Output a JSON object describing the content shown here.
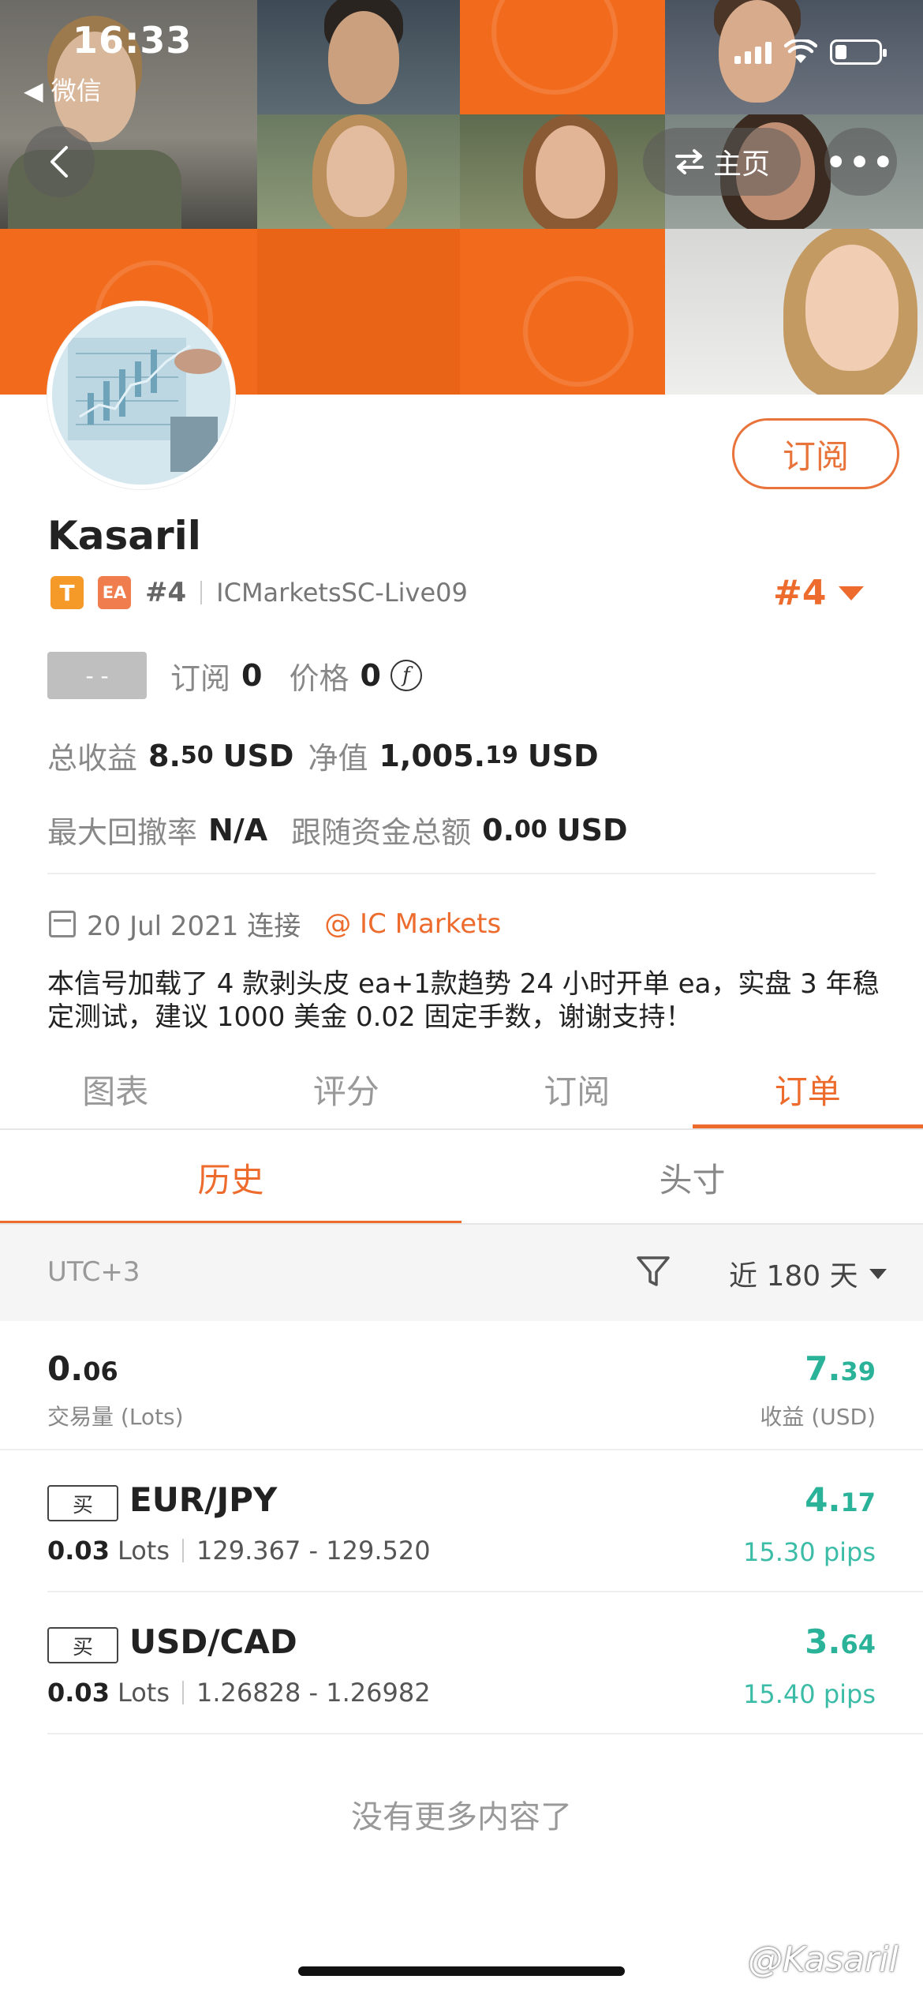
{
  "status_bar": {
    "time": "16:33",
    "back_app": "◀ 微信"
  },
  "nav": {
    "back_icon": "chevron-left-icon",
    "home_label": "主页",
    "more_label": "•••"
  },
  "profile": {
    "subscribe_label": "订阅",
    "name": "Kasaril",
    "badge_t": "T",
    "badge_ea": "EA",
    "rank_small": "#4",
    "server": "ICMarketsSC-Live09",
    "rank_big": "#4",
    "level": "- -",
    "subs_label": "订阅",
    "subs_value": "0",
    "price_label": "价格",
    "price_value": "0",
    "coin_symbol": "f",
    "total_profit_label": "总收益",
    "total_profit_int": "8.",
    "total_profit_dec": "50",
    "total_profit_unit": "USD",
    "equity_label": "净值",
    "equity_int": "1,005.",
    "equity_dec": "19",
    "equity_unit": "USD",
    "max_dd_label": "最大回撤率",
    "max_dd_value": "N/A",
    "follow_funds_label": "跟随资金总额",
    "follow_funds_int": "0.",
    "follow_funds_dec": "00",
    "follow_funds_unit": "USD",
    "connected_date": "20 Jul 2021 连接",
    "broker": "@ IC Markets",
    "description": "本信号加载了 4 款剥头皮 ea+1款趋势 24 小时开单 ea，实盘 3 年稳定测试，建议 1000 美金 0.02 固定手数，谢谢支持！"
  },
  "tabs": [
    {
      "label": "图表",
      "active": false
    },
    {
      "label": "评分",
      "active": false
    },
    {
      "label": "订阅",
      "active": false
    },
    {
      "label": "订单",
      "active": true
    }
  ],
  "subtabs": [
    {
      "label": "历史",
      "active": true
    },
    {
      "label": "头寸",
      "active": false
    }
  ],
  "filter": {
    "timezone": "UTC+3",
    "period": "近 180 天"
  },
  "summary": {
    "volume_int": "0.",
    "volume_dec": "06",
    "volume_label": "交易量 (Lots)",
    "profit_int": "7.",
    "profit_dec": "39",
    "profit_label": "收益 (USD)"
  },
  "orders": [
    {
      "side": "买",
      "pair": "EUR/JPY",
      "lots": "0.03",
      "lots_unit": "Lots",
      "prices": "129.367 - 129.520",
      "profit_int": "4.",
      "profit_dec": "17",
      "pips": "15.30 pips"
    },
    {
      "side": "买",
      "pair": "USD/CAD",
      "lots": "0.03",
      "lots_unit": "Lots",
      "prices": "1.26828 - 1.26982",
      "profit_int": "3.",
      "profit_dec": "64",
      "pips": "15.40 pips"
    }
  ],
  "footer": {
    "no_more": "没有更多内容了",
    "watermark": "@Kasaril"
  },
  "colors": {
    "accent": "#ec6b2d",
    "profit": "#2bb39a",
    "banner": "#f26b1d"
  }
}
